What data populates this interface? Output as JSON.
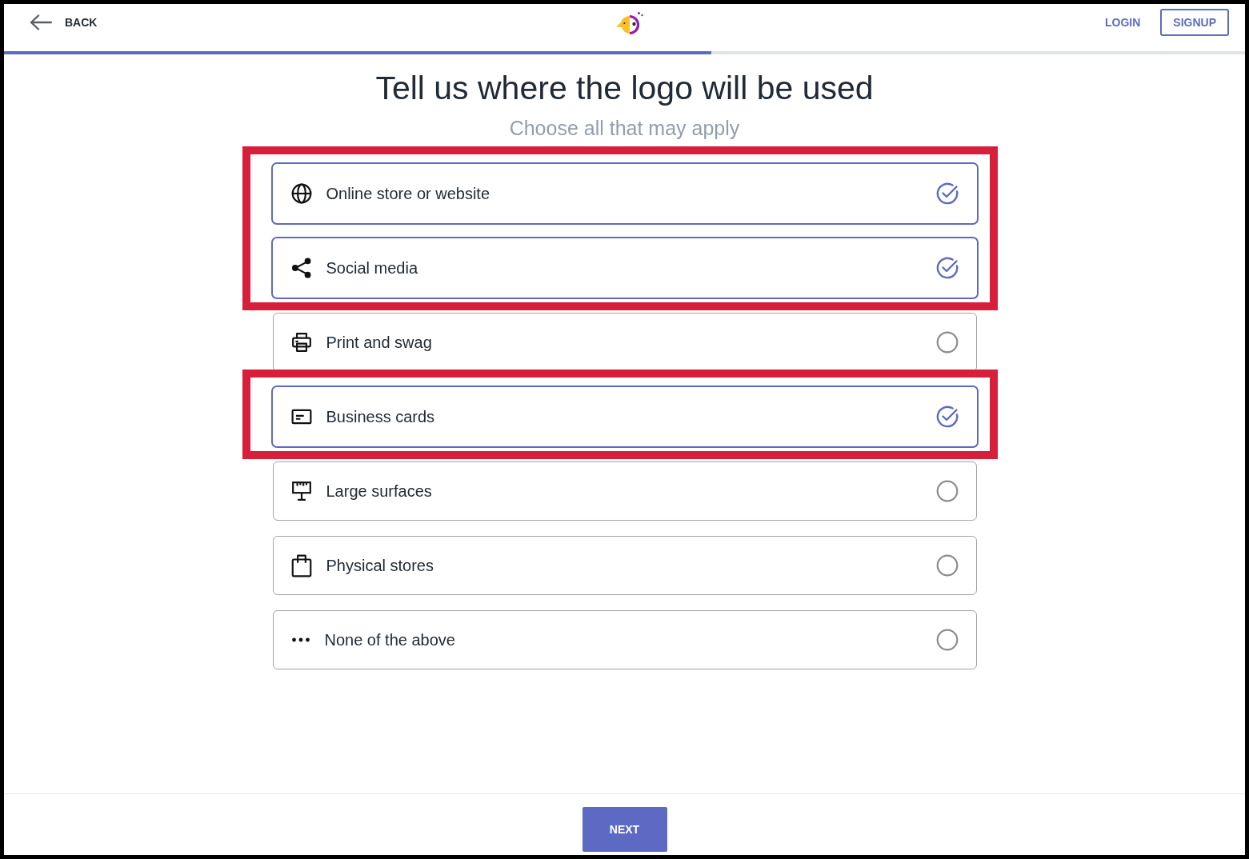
{
  "header": {
    "back": {
      "label": "BACK"
    },
    "login": {
      "label": "LOGIN"
    },
    "signup": {
      "label": "SIGNUP"
    }
  },
  "progress": {
    "level": 0.57
  },
  "title": "Tell us where the logo will be used",
  "subtitle": "Choose all that may apply",
  "options": [
    {
      "label": "Online store or website",
      "selected": true,
      "highlighted": true
    },
    {
      "label": "Social media",
      "selected": true,
      "highlighted": true
    },
    {
      "label": "Print and swag",
      "selected": false,
      "highlighted": false
    },
    {
      "label": "Business cards",
      "selected": true,
      "highlighted": true
    },
    {
      "label": "Large surfaces",
      "selected": false,
      "highlighted": false
    },
    {
      "label": "Physical stores",
      "selected": false,
      "highlighted": false
    },
    {
      "label": "None of the above",
      "selected": false,
      "highlighted": false
    }
  ],
  "footer": {
    "next": {
      "label": "NEXT"
    }
  }
}
